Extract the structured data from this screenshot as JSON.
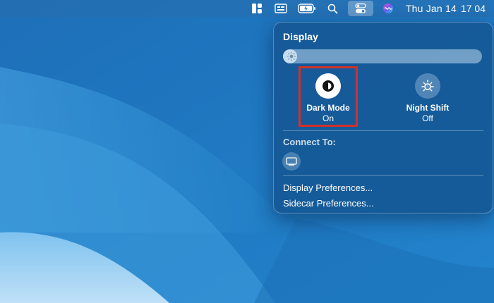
{
  "menubar": {
    "date": "Thu Jan 14",
    "time": "17 04",
    "icons": [
      "app-window-icon",
      "keyboard-input-icon",
      "battery-charging-icon",
      "search-icon",
      "control-center-icon",
      "siri-icon"
    ]
  },
  "panel": {
    "title": "Display",
    "brightness": 0.07,
    "toggles": [
      {
        "label": "Dark Mode",
        "state": "On",
        "icon": "dark-mode-icon"
      },
      {
        "label": "Night Shift",
        "state": "Off",
        "icon": "night-shift-icon"
      }
    ],
    "connect_label": "Connect To:",
    "connect_device_icon": "sidecar-display-icon",
    "menu": [
      "Display Preferences...",
      "Sidecar Preferences..."
    ]
  },
  "colors": {
    "highlight": "#d4302a",
    "desktop": "#1f7cc4",
    "panel": "#1658a0"
  }
}
